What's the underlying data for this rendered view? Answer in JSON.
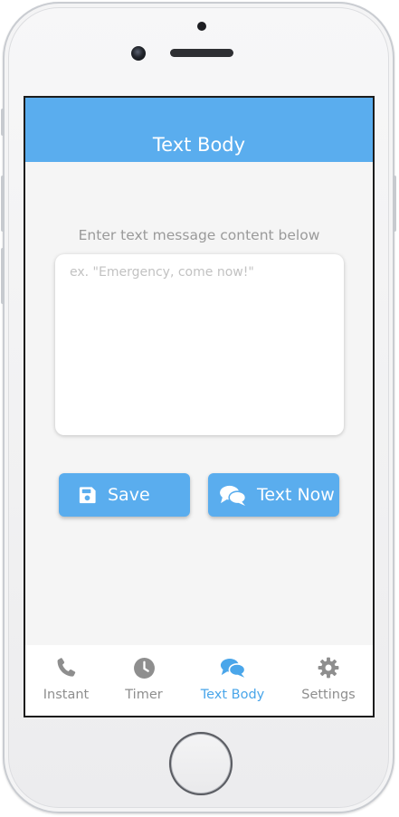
{
  "header": {
    "title": "Text Body"
  },
  "body": {
    "prompt": "Enter text message content below",
    "message_placeholder": "ex. \"Emergency, come now!\""
  },
  "actions": {
    "save_label": "Save",
    "text_now_label": "Text Now"
  },
  "tabs": [
    {
      "label": "Instant",
      "icon": "phone-icon",
      "active": false
    },
    {
      "label": "Timer",
      "icon": "clock-icon",
      "active": false
    },
    {
      "label": "Text Body",
      "icon": "chat-bubbles-icon",
      "active": true
    },
    {
      "label": "Settings",
      "icon": "gear-icon",
      "active": false
    }
  ],
  "colors": {
    "accent": "#5aadee",
    "tab_active": "#4aa6ea",
    "tab_inactive": "#8e8e8e",
    "background": "#f5f5f5"
  }
}
